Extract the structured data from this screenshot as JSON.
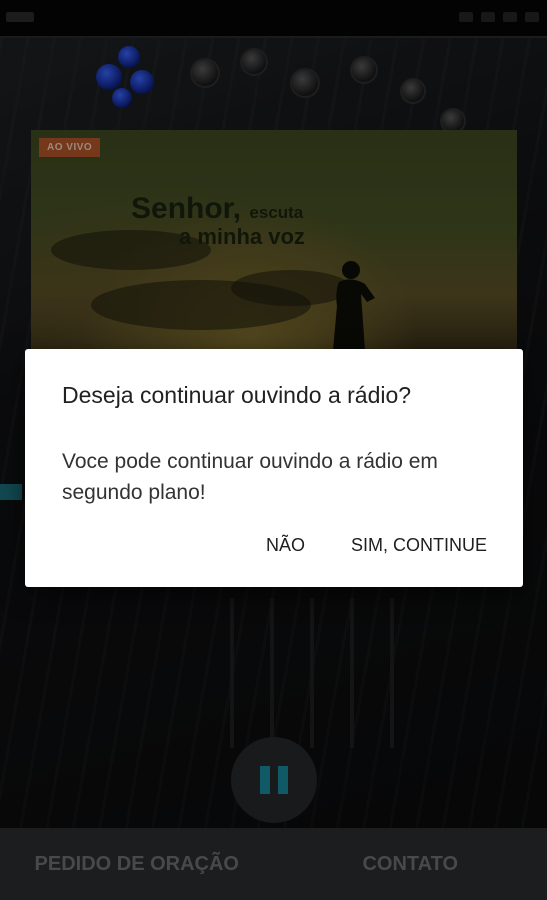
{
  "player": {
    "live_badge": "AO VIVO",
    "artwork_line1": "Senhor,",
    "artwork_line1_small": "escuta",
    "artwork_line2": "a minha voz",
    "accent_color": "#1a8aa0"
  },
  "dialog": {
    "title": "Deseja continuar ouvindo a rádio?",
    "message": "Voce pode continuar ouvindo a rádio em segundo plano!",
    "negative_label": "NÃO",
    "positive_label": "SIM, CONTINUE"
  },
  "bottom_nav": {
    "items": [
      {
        "label": "PEDIDO DE ORAÇÃO"
      },
      {
        "label": "CONTATO"
      }
    ]
  },
  "icons": {
    "pause": "pause-icon"
  }
}
